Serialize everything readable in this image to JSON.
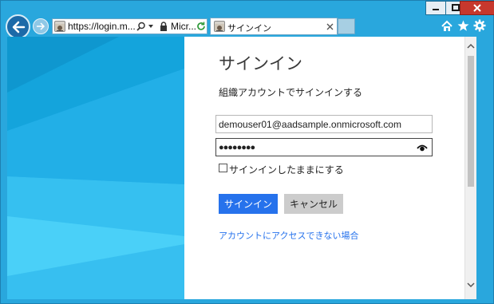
{
  "browser": {
    "address_url": "https://login.m...",
    "site_identity": "Micr...",
    "tab_title": "サインイン"
  },
  "colors": {
    "accent": "#2672ec",
    "brand_bg": "#1ba1e2",
    "frame": "#29a7dd"
  },
  "icons": [
    "back-arrow-icon",
    "forward-arrow-icon",
    "site-favicon",
    "search-icon",
    "dropdown-icon",
    "lock-icon",
    "refresh-icon",
    "close-icon",
    "home-icon",
    "favorites-star-icon",
    "settings-gear-icon",
    "minimize-icon",
    "maximize-icon",
    "window-close-icon",
    "show-password-eye-icon",
    "scroll-up-icon",
    "scroll-down-icon"
  ],
  "signin": {
    "title": "サインイン",
    "subtitle": "組織アカウントでサインインする",
    "username_value": "demouser01@aadsample.onmicrosoft.com",
    "password_mask": "●●●●●●●●",
    "keep_signed_in_label": "サインインしたままにする",
    "keep_signed_in_checked": false,
    "signin_button": "サインイン",
    "cancel_button": "キャンセル",
    "cant_access_link": "アカウントにアクセスできない場合"
  }
}
